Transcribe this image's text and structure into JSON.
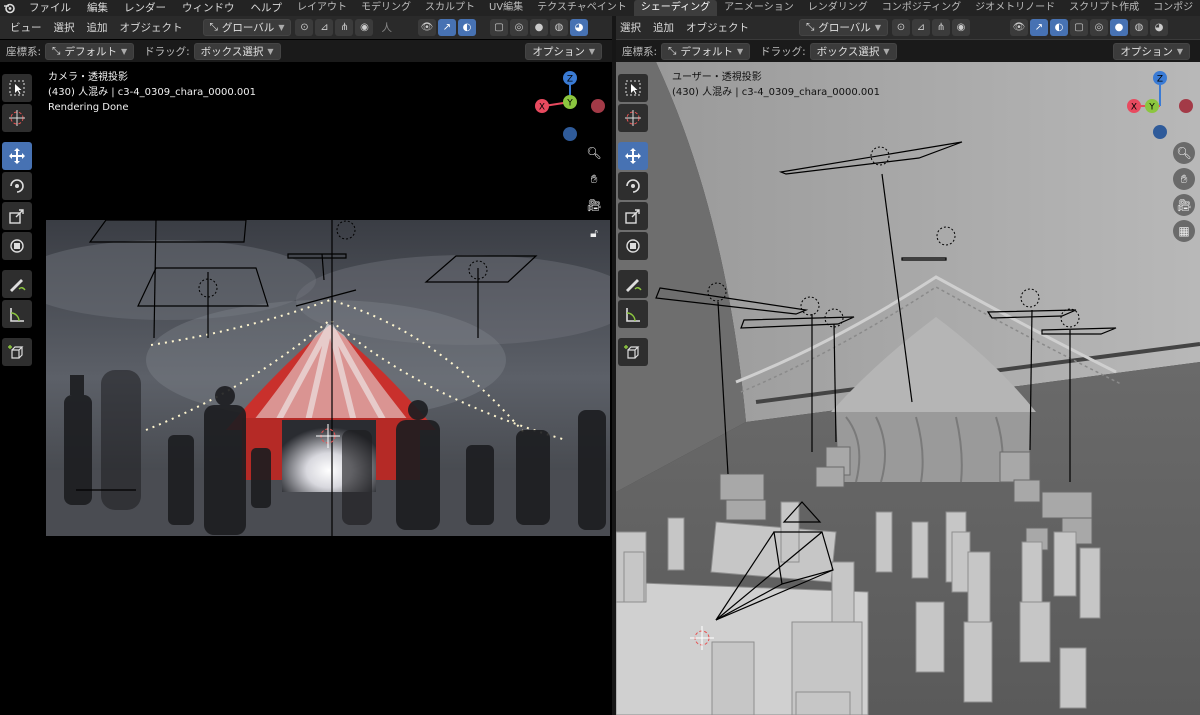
{
  "menubar": {
    "items": [
      "ファイル",
      "編集",
      "レンダー",
      "ウィンドウ",
      "ヘルプ"
    ],
    "workspaces": [
      "レイアウト",
      "モデリング",
      "スカルプト",
      "UV編集",
      "テクスチャペイント",
      "シェーディング",
      "アニメーション",
      "レンダリング",
      "コンポジティング",
      "ジオメトリノード",
      "スクリプト作成",
      "コンポジ"
    ],
    "active_workspace": "シェーディング"
  },
  "left_viewport": {
    "header": {
      "menus": [
        "ビュー",
        "選択",
        "追加",
        "オブジェクト"
      ],
      "transform_orientation": "グローバル",
      "snap_target": "人"
    },
    "subheader": {
      "coord_label": "座標系:",
      "coord_value": "デフォルト",
      "drag_label": "ドラッグ:",
      "drag_value": "ボックス選択",
      "options": "オプション"
    },
    "info": {
      "view_name": "カメラ・透視投影",
      "collection": "(430) 人混み | c3-4_0309_chara_0000.001",
      "status": "Rendering Done"
    }
  },
  "right_viewport": {
    "header": {
      "menus": [
        "選択",
        "追加",
        "オブジェクト"
      ],
      "transform_orientation": "グローバル"
    },
    "subheader": {
      "coord_label": "座標系:",
      "coord_value": "デフォルト",
      "drag_label": "ドラッグ:",
      "drag_value": "ボックス選択",
      "options": "オプション"
    },
    "info": {
      "view_name": "ユーザー・透視投影",
      "collection": "(430) 人混み | c3-4_0309_chara_0000.001"
    }
  },
  "gizmo_axes": {
    "z": "Z",
    "y": "Y",
    "x": "X"
  },
  "colors": {
    "accent": "#4772b3",
    "x_axis": "#e84a5f",
    "y_axis": "#8cc63f",
    "z_axis": "#3a7bd5",
    "tent_red": "#c9302c"
  },
  "icons": {
    "toolbar": [
      "select-box-icon",
      "cursor-icon",
      "move-icon",
      "rotate-icon",
      "scale-icon",
      "transform-icon",
      "annotate-icon",
      "measure-icon",
      "add-cube-icon"
    ],
    "left_nav": [
      "zoom-icon",
      "hand-pan-icon",
      "camera-view-icon",
      "lock-icon"
    ],
    "right_nav": [
      "zoom-icon",
      "hand-pan-icon",
      "camera-view-icon",
      "grid-ortho-icon"
    ]
  }
}
